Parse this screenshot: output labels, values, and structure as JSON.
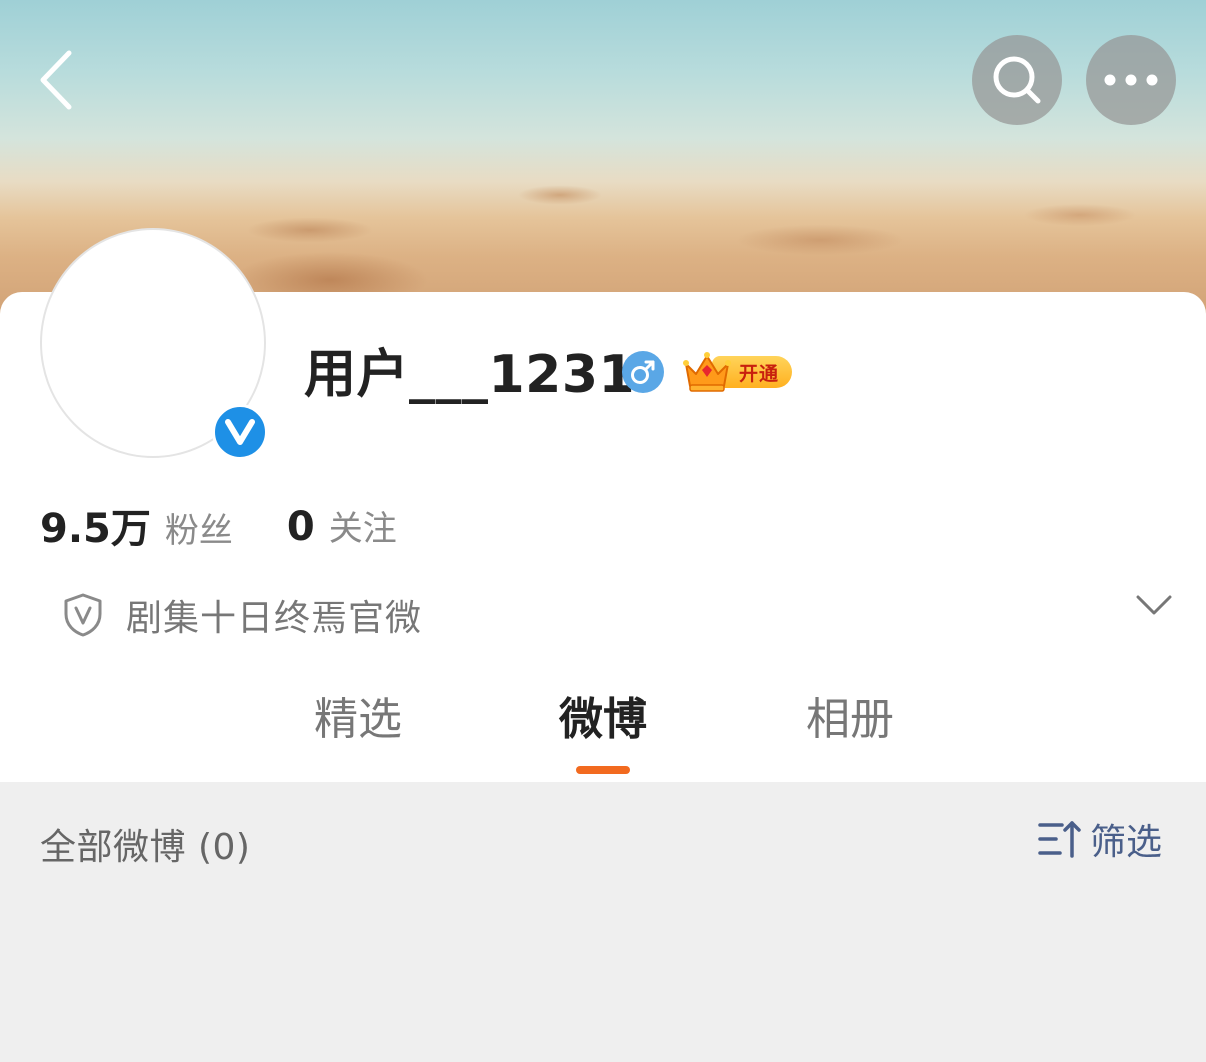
{
  "header": {
    "back_icon": "chevron-left-icon",
    "search_icon": "search-icon",
    "more_icon": "more-horizontal-icon"
  },
  "profile": {
    "username": "用户___1231",
    "verified_badge": "V",
    "gender_icon": "male-icon",
    "vip_label": "开通",
    "followers_count": "9.5万",
    "followers_label": "粉丝",
    "following_count": "0",
    "following_label": "关注",
    "intro_text": "剧集十日终焉官微"
  },
  "tabs": [
    {
      "label": "精选",
      "active": false
    },
    {
      "label": "微博",
      "active": true
    },
    {
      "label": "相册",
      "active": false
    }
  ],
  "feed": {
    "all_posts_label": "全部微博 (0)",
    "filter_label": "筛选"
  },
  "colors": {
    "accent": "#f26a1f",
    "verify_blue": "#1e90e6",
    "filter_blue": "#4a5f8a"
  }
}
